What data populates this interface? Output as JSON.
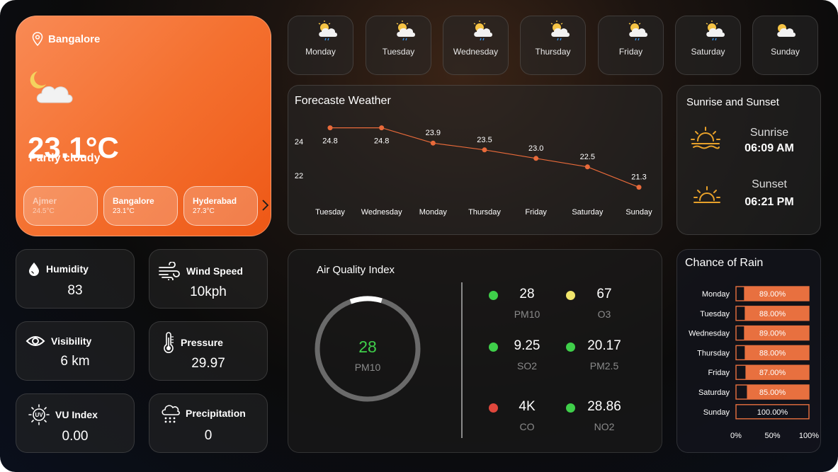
{
  "location": {
    "city": "Bangalore",
    "temperature": "23.1°C",
    "condition": "Partly cloudy",
    "cities": [
      {
        "name": "Ajmer",
        "temp": "24.5°C"
      },
      {
        "name": "Bangalore",
        "temp": "23.1°C"
      },
      {
        "name": "Hyderabad",
        "temp": "27.3°C"
      }
    ]
  },
  "days": [
    "Monday",
    "Tuesday",
    "Wednesday",
    "Thursday",
    "Friday",
    "Saturday",
    "Sunday"
  ],
  "forecast": {
    "title": "Forecaste Weather",
    "chart_data": {
      "type": "line",
      "categories": [
        "Tuesday",
        "Wednesday",
        "Monday",
        "Thursday",
        "Friday",
        "Saturday",
        "Sunday"
      ],
      "values": [
        24.8,
        24.8,
        23.9,
        23.5,
        23.0,
        22.5,
        21.3
      ],
      "value_labels": [
        "24.8",
        "24.8",
        "23.9",
        "23.5",
        "23.0",
        "22.5",
        "21.3"
      ],
      "yticks": [
        22,
        24
      ],
      "ylim": [
        20.7,
        25.2
      ],
      "color": "#e86a3a",
      "grid": false
    }
  },
  "sun": {
    "title": "Sunrise and Sunset",
    "sunrise_label": "Sunrise",
    "sunrise_time": "06:09 AM",
    "sunset_label": "Sunset",
    "sunset_time": "06:21 PM"
  },
  "stats": {
    "humidity": {
      "label": "Humidity",
      "value": "83"
    },
    "wind": {
      "label": "Wind Speed",
      "value": "10kph"
    },
    "visibility": {
      "label": "Visibility",
      "value": "6 km"
    },
    "pressure": {
      "label": "Pressure",
      "value": "29.97"
    },
    "uv": {
      "label": "VU Index",
      "value": "0.00"
    },
    "precip": {
      "label": "Precipitation",
      "value": "0"
    }
  },
  "aqi": {
    "title": "Air Quality Index",
    "gauge_value": "28",
    "gauge_label": "PM10",
    "gauge_fraction": 0.1,
    "items": [
      {
        "value": "28",
        "label": "PM10",
        "color": "#3fcf4a"
      },
      {
        "value": "67",
        "label": "O3",
        "color": "#f1e56b"
      },
      {
        "value": "9.25",
        "label": "SO2",
        "color": "#3fcf4a"
      },
      {
        "value": "20.17",
        "label": "PM2.5",
        "color": "#3fcf4a"
      },
      {
        "value": "4K",
        "label": "CO",
        "color": "#e0473c"
      },
      {
        "value": "28.86",
        "label": "NO2",
        "color": "#3fcf4a"
      }
    ]
  },
  "rain": {
    "title": "Chance of Rain",
    "chart_data": {
      "type": "bar",
      "orientation": "horizontal",
      "categories": [
        "Monday",
        "Tuesday",
        "Wednesday",
        "Thursday",
        "Friday",
        "Saturday",
        "Sunday"
      ],
      "values": [
        89,
        88,
        89,
        88,
        87,
        85,
        100
      ],
      "value_labels": [
        "89.00%",
        "88.00%",
        "89.00%",
        "88.00%",
        "87.00%",
        "85.00%",
        "100.00%"
      ],
      "xticks": [
        "0%",
        "50%",
        "100%"
      ],
      "xlim": [
        0,
        100
      ],
      "color": "#e8703f"
    }
  }
}
